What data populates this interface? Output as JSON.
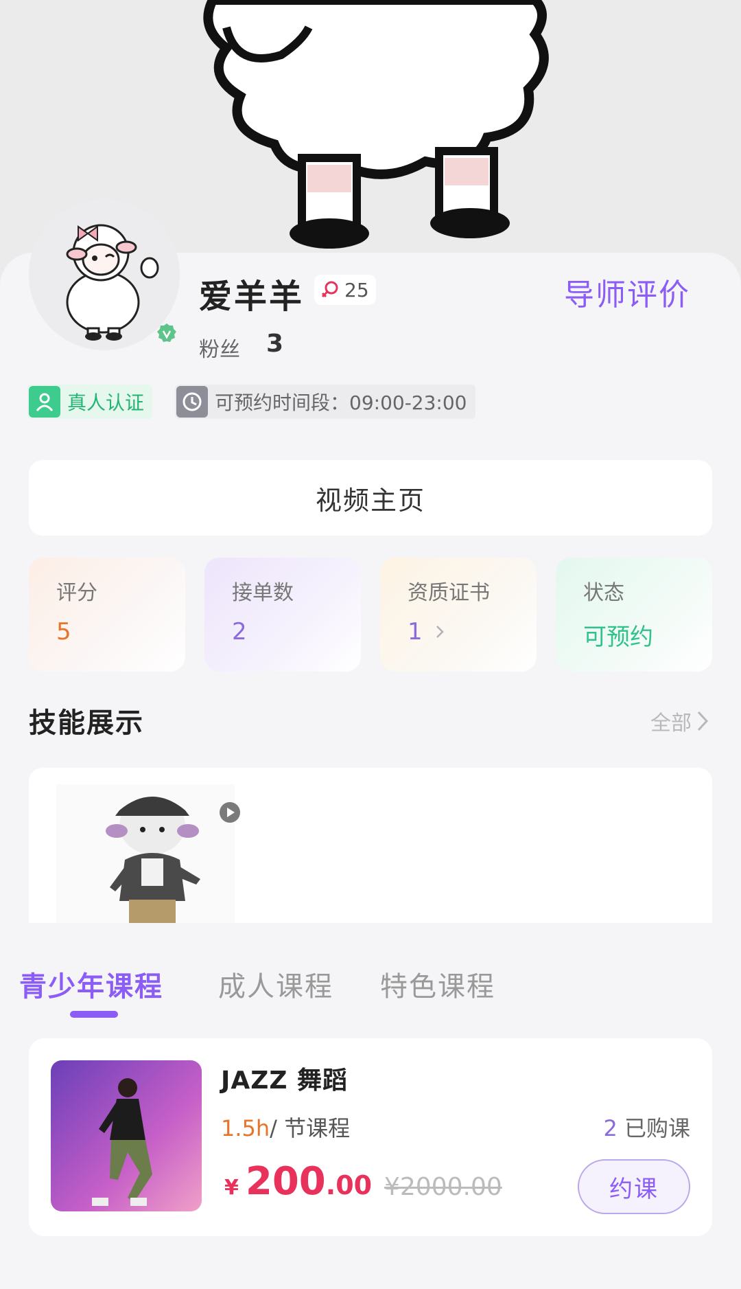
{
  "profile": {
    "name": "爱羊羊",
    "age": "25",
    "review_link": "导师评价",
    "fans_label": "粉丝",
    "fans_count": "3"
  },
  "tags": {
    "verified": "真人认证",
    "booking_hours": "可预约时间段：09:00-23:00"
  },
  "video_home_label": "视频主页",
  "stats": [
    {
      "label": "评分",
      "value": "5"
    },
    {
      "label": "接单数",
      "value": "2"
    },
    {
      "label": "资质证书",
      "value": "1"
    },
    {
      "label": "状态",
      "value": "可预约"
    }
  ],
  "skills": {
    "title": "技能展示",
    "all_label": "全部"
  },
  "course_tabs": [
    "青少年课程",
    "成人课程",
    "特色课程"
  ],
  "active_tab": "青少年课程",
  "course": {
    "name": "JAZZ 舞蹈",
    "duration_value": "1.5h",
    "duration_suffix": "/ 节课程",
    "sold_count": "2",
    "sold_label": "已购课",
    "currency": "¥",
    "price_int": "200",
    "price_dec": ".00",
    "original_price": "¥2000.00",
    "book_label": "约课"
  },
  "colors": {
    "accent": "#8b5cf6",
    "price": "#e8315b",
    "verified_green": "#22b573"
  }
}
